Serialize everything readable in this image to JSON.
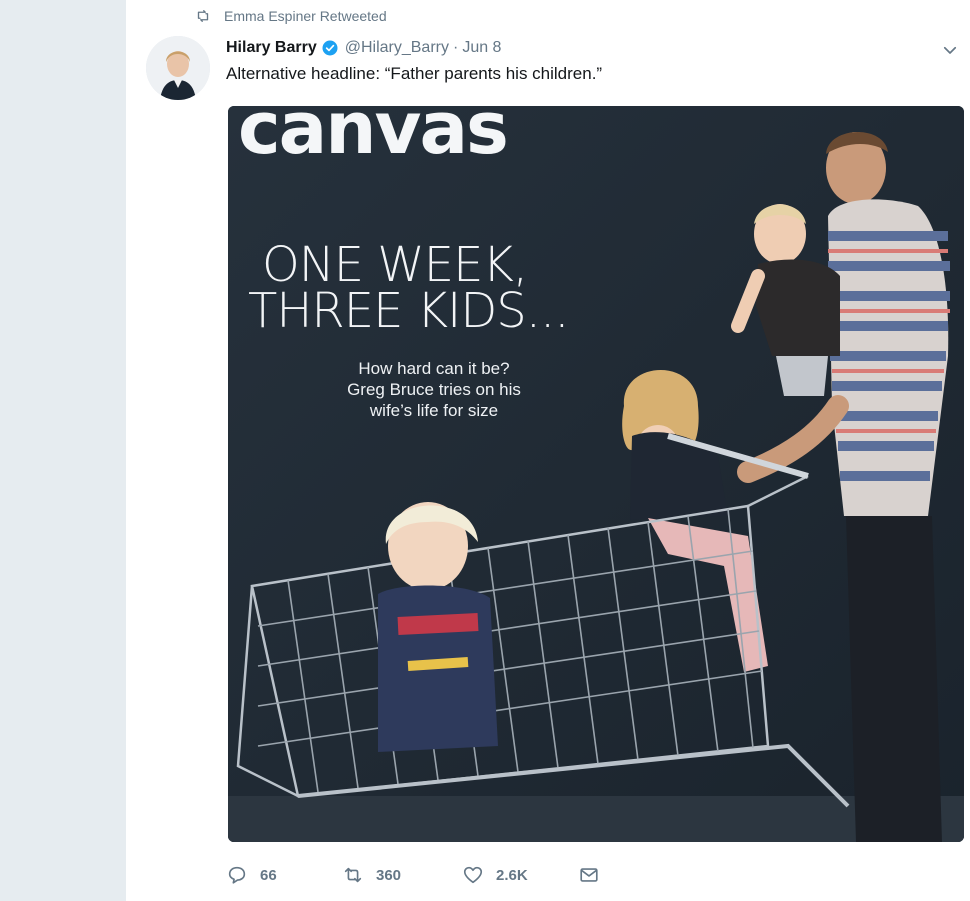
{
  "retweet_context": {
    "text": "Emma Espiner Retweeted"
  },
  "tweet": {
    "fullname": "Hilary Barry",
    "username": "@Hilary_Barry",
    "time": "Jun 8",
    "text": "Alternative headline: “Father parents his children.”"
  },
  "media": {
    "magazine_name": "canvas",
    "headline_line1": "ONE WEEK,",
    "headline_line2": "THREE KIDS...",
    "subhead_line1": "How hard can it be?",
    "subhead_line2": "Greg Bruce tries on his",
    "subhead_line3": "wife’s life for size"
  },
  "actions": {
    "reply_count": "66",
    "retweet_count": "360",
    "like_count": "2.6K"
  },
  "icons": {
    "retweet": "retweet-icon",
    "verified": "verified-badge-icon",
    "caret": "chevron-down-icon",
    "reply": "reply-icon",
    "like": "heart-icon",
    "dm": "envelope-icon"
  },
  "colors": {
    "accent": "#1da1f2",
    "muted": "#657786",
    "text": "#14171a",
    "page_bg": "#e6ecf0"
  }
}
